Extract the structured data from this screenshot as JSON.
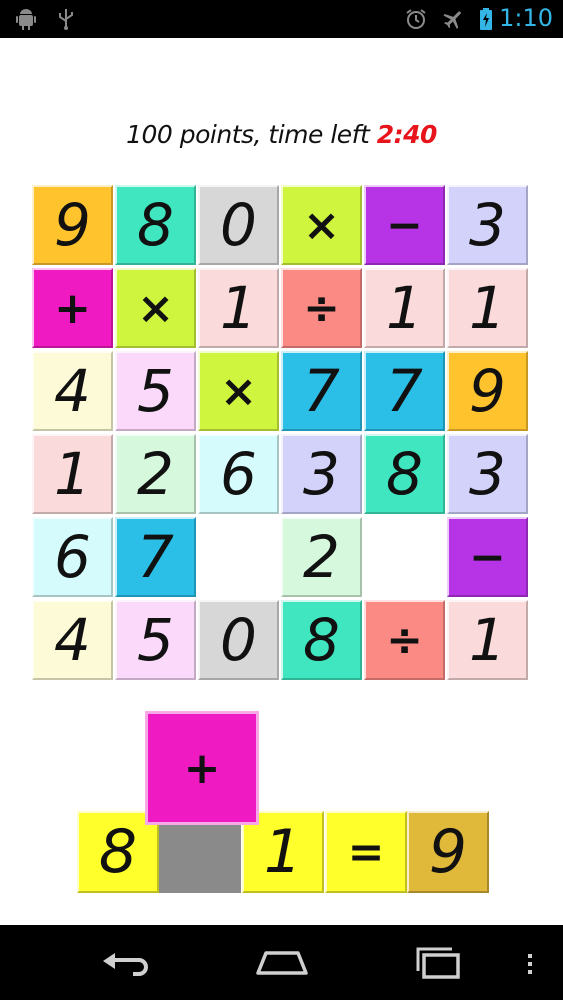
{
  "status": {
    "clock": "1:10"
  },
  "score": {
    "prefix": "100 points, time left ",
    "timer": "2:40"
  },
  "colors": {
    "status_accent": "#33b5e5",
    "timer": "#e8141b",
    "selected_slot": "#8a8a8a"
  },
  "board": {
    "rows": [
      [
        {
          "v": "9",
          "c": "#ffc32e"
        },
        {
          "v": "8",
          "c": "#3fe6c0"
        },
        {
          "v": "0",
          "c": "#d7d7d7"
        },
        {
          "v": "×",
          "c": "#cff53e"
        },
        {
          "v": "−",
          "c": "#b634e6"
        },
        {
          "v": "3",
          "c": "#d2d2fb"
        }
      ],
      [
        {
          "v": "+",
          "c": "#f01ac2"
        },
        {
          "v": "×",
          "c": "#cff53e"
        },
        {
          "v": "1",
          "c": "#fadada"
        },
        {
          "v": "÷",
          "c": "#fb8a84"
        },
        {
          "v": "1",
          "c": "#fadada"
        },
        {
          "v": "1",
          "c": "#fadada"
        }
      ],
      [
        {
          "v": "4",
          "c": "#fdfbd7"
        },
        {
          "v": "5",
          "c": "#fad9fb"
        },
        {
          "v": "×",
          "c": "#cff53e"
        },
        {
          "v": "7",
          "c": "#2bbfe8"
        },
        {
          "v": "7",
          "c": "#2bbfe8"
        },
        {
          "v": "9",
          "c": "#ffc32e"
        }
      ],
      [
        {
          "v": "1",
          "c": "#fadada"
        },
        {
          "v": "2",
          "c": "#d6f8dc"
        },
        {
          "v": "6",
          "c": "#d6fbfd"
        },
        {
          "v": "3",
          "c": "#d2d2fb"
        },
        {
          "v": "8",
          "c": "#3fe6c0"
        },
        {
          "v": "3",
          "c": "#d2d2fb"
        }
      ],
      [
        {
          "v": "6",
          "c": "#d6fbfd"
        },
        {
          "v": "7",
          "c": "#2bbfe8"
        },
        {
          "v": "",
          "c": ""
        },
        {
          "v": "2",
          "c": "#d6f8dc"
        },
        {
          "v": "",
          "c": ""
        },
        {
          "v": "−",
          "c": "#b634e6"
        }
      ],
      [
        {
          "v": "4",
          "c": "#fdfbd7"
        },
        {
          "v": "5",
          "c": "#fad9fb"
        },
        {
          "v": "0",
          "c": "#d7d7d7"
        },
        {
          "v": "8",
          "c": "#3fe6c0"
        },
        {
          "v": "÷",
          "c": "#fb8a84"
        },
        {
          "v": "1",
          "c": "#fadada"
        }
      ]
    ]
  },
  "equation": {
    "pending_operator": {
      "v": "+",
      "c": "#f01ac2"
    },
    "tiles": [
      {
        "v": "8",
        "c": "#ffff2b"
      },
      {
        "v": "",
        "c": "#8a8a8a"
      },
      {
        "v": "1",
        "c": "#ffff2b"
      },
      {
        "v": "=",
        "c": "#ffff2b"
      },
      {
        "v": "9",
        "c": "#e0b93a"
      }
    ]
  },
  "nav": {
    "icons": [
      "back-icon",
      "home-icon",
      "recent-apps-icon"
    ]
  }
}
